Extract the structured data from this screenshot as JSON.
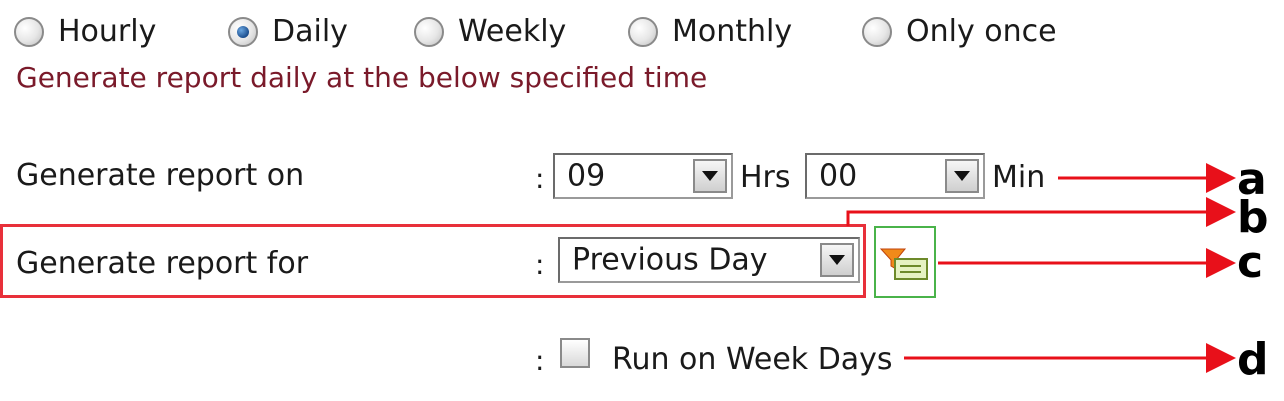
{
  "frequency": {
    "options": [
      {
        "label": "Hourly",
        "checked": false
      },
      {
        "label": "Daily",
        "checked": true
      },
      {
        "label": "Weekly",
        "checked": false
      },
      {
        "label": "Monthly",
        "checked": false
      },
      {
        "label": "Only once",
        "checked": false
      }
    ],
    "hint": "Generate report daily at the below specified time"
  },
  "generate_on": {
    "label": "Generate report on",
    "colon": ":",
    "hours_value": "09",
    "hours_unit": "Hrs",
    "minutes_value": "00",
    "minutes_unit": "Min"
  },
  "generate_for": {
    "label": "Generate report for",
    "colon": ":",
    "value": "Previous Day"
  },
  "run_on_week_days": {
    "colon": ":",
    "label": "Run on Week Days",
    "checked": false
  },
  "callouts": {
    "a": "a",
    "b": "b",
    "c": "c",
    "d": "d"
  },
  "colors": {
    "hint": "#7a1a2a",
    "highlight_box": "#e8303a",
    "filter_box": "#4ab34a",
    "arrow": "#e8101a"
  },
  "icons": {
    "combo_button": "chevron-down-icon",
    "filter": "filter-icon"
  }
}
